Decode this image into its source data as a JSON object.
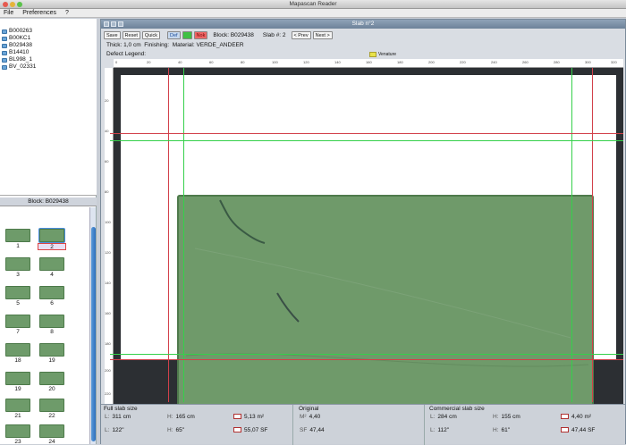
{
  "app": {
    "title": "Mapascan Reader",
    "menus": [
      "File",
      "Preferences",
      "?"
    ]
  },
  "blocks": {
    "items": [
      "B000263",
      "B00KC1",
      "B029438",
      "B14410",
      "BL998_1",
      "BV_02331"
    ]
  },
  "block_panel": {
    "title": "Block: B029438",
    "thumbs": [
      "1",
      "2",
      "3",
      "4",
      "5",
      "6",
      "7",
      "8",
      "18",
      "19",
      "19",
      "20",
      "21",
      "22",
      "23",
      "24"
    ],
    "selected": "2"
  },
  "slab_window": {
    "title": "Slab n°2",
    "toolbar": {
      "save": "Save",
      "reset": "Reset",
      "quick": "Quick",
      "def": "Def",
      "ok": "",
      "nok": "Nok",
      "block": "Block: B029438",
      "slab": "Slab #: 2",
      "prev": "< Prev",
      "next": "Next >"
    },
    "info": {
      "thickness": "Thick: 1,0 cm",
      "finishing": "Finishing:",
      "material": "Material: VERDE_ANDEER"
    },
    "defect_legend": {
      "label": "Defect Legend:",
      "entries": [
        {
          "name": "Venature",
          "color": "#e8e24a"
        }
      ]
    },
    "ruler_top": [
      "0",
      "20",
      "40",
      "60",
      "80",
      "100",
      "120",
      "140",
      "160",
      "180",
      "200",
      "220",
      "240",
      "260",
      "280",
      "300",
      "320"
    ],
    "ruler_left": [
      "20",
      "40",
      "60",
      "80",
      "100",
      "120",
      "140",
      "160",
      "180",
      "200",
      "220"
    ]
  },
  "bottom": {
    "full": {
      "title": "Full slab size",
      "l_cm": "311 cm",
      "h_cm": "165 cm",
      "area_m": "5,13 m²",
      "l_in": "122\"",
      "h_in": "65\"",
      "area_sf": "55,07 SF"
    },
    "original": {
      "title": "Original",
      "m": "4,40",
      "sf": "47,44",
      "m_lbl": "M²",
      "sf_lbl": "SF"
    },
    "commercial": {
      "title": "Commercial slab size",
      "l_cm": "284 cm",
      "h_cm": "155 cm",
      "area_m": "4,40 m²",
      "l_in": "112\"",
      "h_in": "61\"",
      "area_sf": "47,44 SF"
    },
    "labels": {
      "l": "L:",
      "h": "H:"
    }
  },
  "colors": {
    "red_guide": "#d2404a",
    "green_guide": "#35d04a",
    "slab": "#6f9a6a",
    "accent": "#2e6fbe"
  }
}
